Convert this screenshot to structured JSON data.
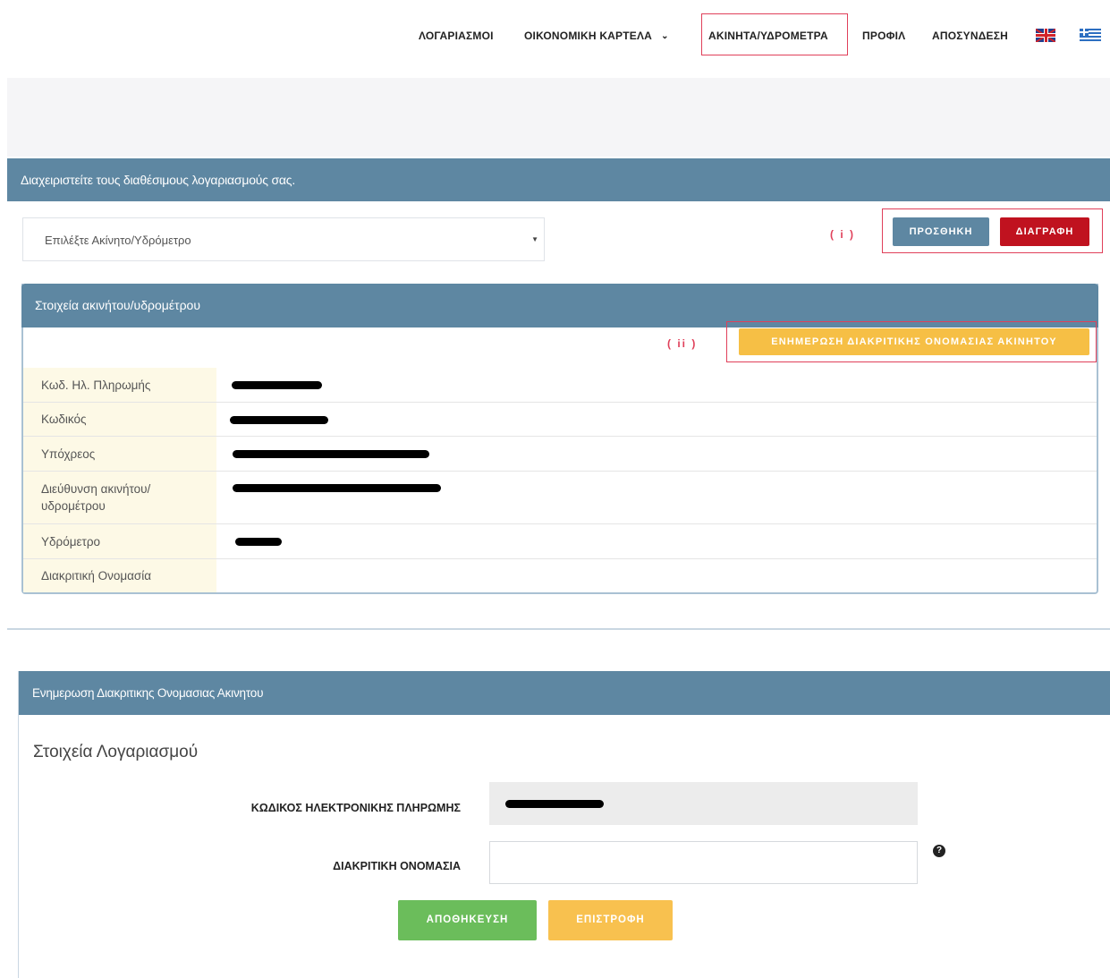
{
  "nav": {
    "accounts": "ΛΟΓΑΡΙΑΣΜΟΙ",
    "financial": "ΟΙΚΟΝΟΜΙΚΗ ΚΑΡΤΕΛΑ",
    "properties": "ΑΚΙΝΗΤΑ/ΥΔΡΟΜΕΤΡΑ",
    "profile": "ΠΡΟΦΙΛ",
    "logout": "ΑΠΟΣΥΝΔΕΣΗ",
    "chevron": "⌄"
  },
  "panel1": {
    "header": "Διαχειριστείτε τους διαθέσιμους λογαριασμούς σας.",
    "select_placeholder": "Επιλέξτε Ακίνητο/Υδρόμετρο",
    "marker_i": "( i )",
    "add_button": "ΠΡΟΣΘΗΚΗ",
    "delete_button": "ΔΙΑΓΡΑΦΗ"
  },
  "details": {
    "header": "Στοιχεία ακινήτου/υδρομέτρου",
    "marker_ii": "( ii )",
    "update_button": "ΕΝΗΜΕΡΩΣΗ ΔΙΑΚΡΙΤΙΚΗΣ ΟΝΟΜΑΣΙΑΣ ΑΚΙΝΗΤΟΥ",
    "rows": [
      {
        "label": "Κωδ. Ηλ. Πληρωμής"
      },
      {
        "label": "Κωδικός"
      },
      {
        "label": "Υπόχρεος"
      },
      {
        "label": "Διεύθυνση ακινήτου/ υδρομέτρου"
      },
      {
        "label": "Υδρόμετρο"
      },
      {
        "label": "Διακριτική Ονομασία"
      }
    ]
  },
  "panel2": {
    "header": "Ενημερωση Διακριτικης Ονομασιας Ακινητου",
    "subtitle": "Στοιχεία Λογαριασμού",
    "payment_code_label": "ΚΩΔΙΚΟΣ ΗΛΕΚΤΡΟΝΙΚΗΣ ΠΛΗΡΩΜΗΣ",
    "name_label": "ΔΙΑΚΡΙΤΙΚΗ ΟΝΟΜΑΣΙΑ",
    "name_value": "",
    "help": "?",
    "save_button": "ΑΠΟΘΗΚΕΥΣΗ",
    "back_button": "ΕΠΙΣΤΡΟΦΗ"
  },
  "colors": {
    "header_bg": "#5e87a2",
    "danger": "#c0121f",
    "warning": "#f6bf45",
    "success": "#6bbd5b",
    "highlight_border": "#e0405a",
    "label_bg": "#fdf9e6"
  }
}
